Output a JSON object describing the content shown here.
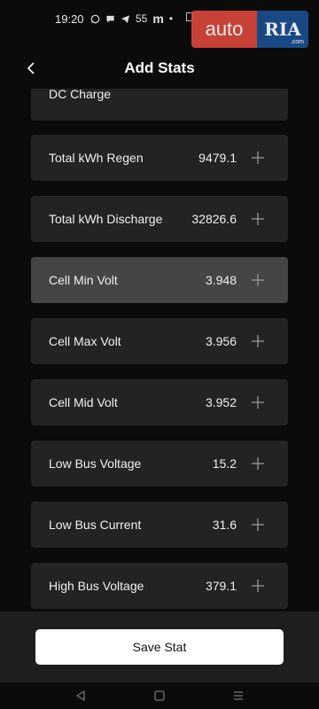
{
  "status_bar": {
    "time": "19:20",
    "network_count": "55",
    "app_letter": "m"
  },
  "watermark": {
    "left_text": "auto",
    "right_text": "RIA",
    "right_small": ".com"
  },
  "header": {
    "title": "Add Stats",
    "back_icon": "chevron-left-icon"
  },
  "stats": {
    "partial_label": "DC Charge",
    "items": [
      {
        "label": "Total kWh Regen",
        "value": "9479.1",
        "selected": false
      },
      {
        "label": "Total kWh Discharge",
        "value": "32826.6",
        "selected": false
      },
      {
        "label": "Cell Min Volt",
        "value": "3.948",
        "selected": true
      },
      {
        "label": "Cell Max Volt",
        "value": "3.956",
        "selected": false
      },
      {
        "label": "Cell Mid Volt",
        "value": "3.952",
        "selected": false
      },
      {
        "label": "Low Bus Voltage",
        "value": "15.2",
        "selected": false
      },
      {
        "label": "Low Bus Current",
        "value": "31.6",
        "selected": false
      },
      {
        "label": "High Bus Voltage",
        "value": "379.1",
        "selected": false
      }
    ]
  },
  "footer": {
    "save_label": "Save Stat"
  },
  "colors": {
    "background": "#0b0b0b",
    "row_background": "#232323",
    "row_selected": "#454545",
    "footer_background": "#1e1e1e",
    "save_button": "#ffffff"
  },
  "nav_bar": {
    "back": "triangle-back-icon",
    "home": "square-home-icon",
    "recents": "menu-recents-icon"
  }
}
